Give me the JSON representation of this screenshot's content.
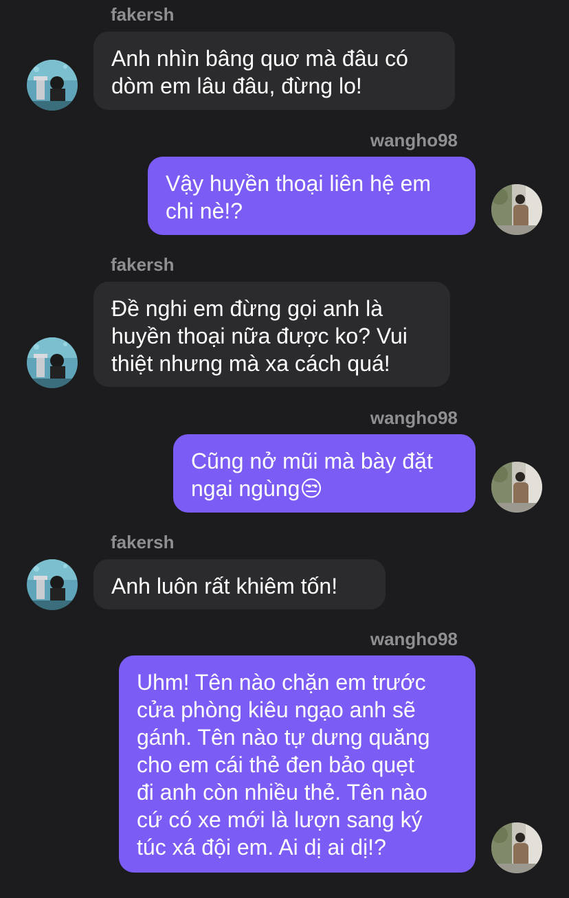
{
  "colors": {
    "background": "#1c1c1e",
    "incoming_bubble": "#2b2b2e",
    "outgoing_bubble": "#7b5cf5",
    "username": "#8e8e93"
  },
  "messages": [
    {
      "sender": "fakersh",
      "direction": "incoming",
      "text": "Anh nhìn bâng quơ mà đâu có\ndòm em lâu đâu, đừng lo!"
    },
    {
      "sender": "wangho98",
      "direction": "outgoing",
      "text": "Vậy huyền thoại liên hệ em\nchi nè!?"
    },
    {
      "sender": "fakersh",
      "direction": "incoming",
      "text": "Đề nghi em đừng gọi anh là\nhuyền thoại nữa được ko? Vui\nthiệt nhưng mà xa cách quá!"
    },
    {
      "sender": "wangho98",
      "direction": "outgoing",
      "text": "Cũng nở mũi mà bày đặt\nngại ngùng😒"
    },
    {
      "sender": "fakersh",
      "direction": "incoming",
      "text": "Anh luôn rất khiêm tốn!"
    },
    {
      "sender": "wangho98",
      "direction": "outgoing",
      "text": "Uhm! Tên nào chặn em trước\ncửa phòng kiêu ngạo anh sẽ\ngánh. Tên nào tự dưng quăng\ncho em cái thẻ đen bảo quẹt\nđi anh còn nhiều thẻ. Tên nào\ncứ có xe mới là lượn sang ký\ntúc xá đội em. Ai dị ai dị!?"
    }
  ],
  "avatars": {
    "fakersh": "trophy-photo-avatar",
    "wangho98": "street-photo-avatar"
  }
}
